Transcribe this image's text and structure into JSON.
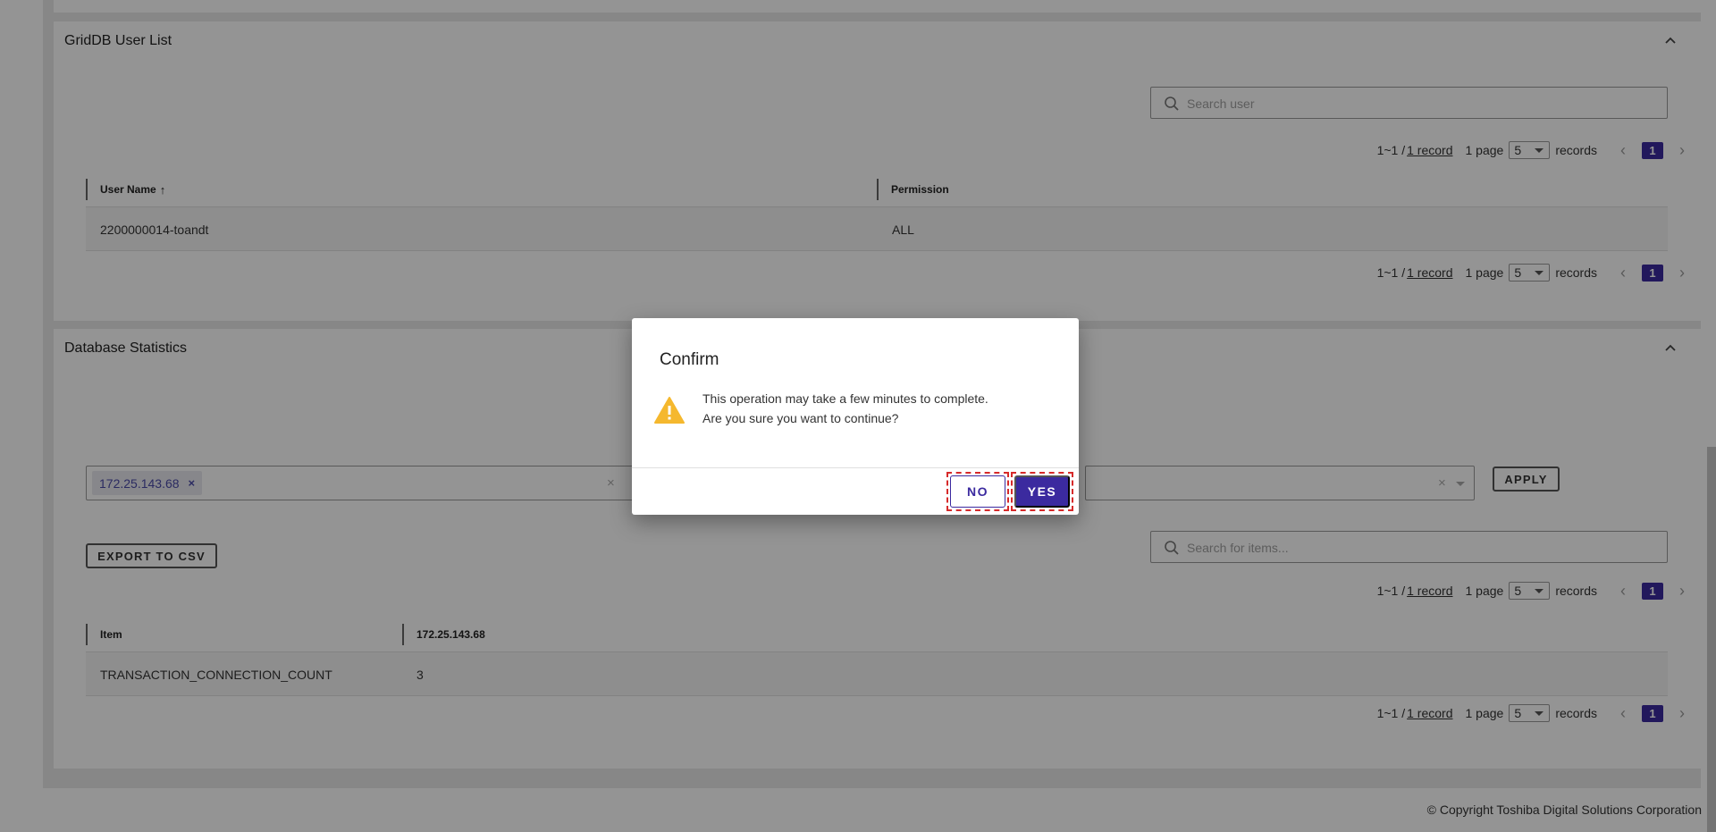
{
  "user_list": {
    "title": "GridDB User List",
    "search_placeholder": "Search user",
    "columns": [
      "User Name",
      "Permission"
    ],
    "sort_arrow": "↑",
    "rows": [
      {
        "user_name": "2200000014-toandt",
        "permission": "ALL"
      }
    ]
  },
  "stats": {
    "title": "Database Statistics",
    "host_chip": "172.25.143.68",
    "chip_remove": "×",
    "clear_mark": "×",
    "apply_label": "APPLY",
    "export_label": "EXPORT TO CSV",
    "search_placeholder": "Search for items...",
    "columns": [
      "Item",
      "172.25.143.68"
    ],
    "rows": [
      {
        "item": "TRANSACTION_CONNECTION_COUNT",
        "value": "3"
      }
    ]
  },
  "pager": {
    "range": "1~1 /",
    "records_link": "1 record",
    "pages": "1 page",
    "page_size": "5",
    "records_label": "records",
    "current_page": "1",
    "prev": "‹",
    "next": "›"
  },
  "dialog": {
    "title": "Confirm",
    "message_line1": "This operation may take a few minutes to complete.",
    "message_line2": "Are you sure you want to continue?",
    "no_label": "NO",
    "yes_label": "YES"
  },
  "footer": {
    "copyright": "© Copyright Toshiba Digital Solutions Corporation"
  },
  "colors": {
    "primary": "#3b2a9f",
    "warning": "#f5b82e",
    "highlight_frame": "#d62a2a"
  },
  "icons": {
    "search": "search-icon",
    "collapse": "chevron-up-icon",
    "warning": "warning-icon"
  }
}
